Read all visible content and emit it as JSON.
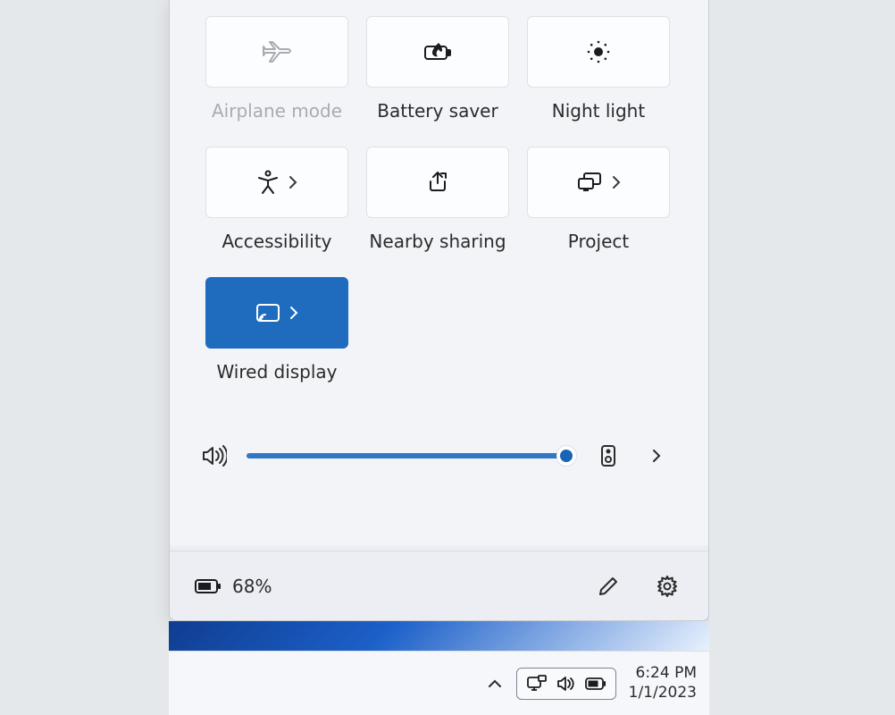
{
  "tiles": {
    "airplane": {
      "label": "Airplane mode"
    },
    "battery_saver": {
      "label": "Battery saver"
    },
    "night_light": {
      "label": "Night light"
    },
    "accessibility": {
      "label": "Accessibility"
    },
    "nearby": {
      "label": "Nearby sharing"
    },
    "project": {
      "label": "Project"
    },
    "wired_display": {
      "label": "Wired display",
      "active": true
    }
  },
  "volume": {
    "percent": 97
  },
  "battery": {
    "percent_label": "68%"
  },
  "taskbar": {
    "time": "6:24 PM",
    "date": "1/1/2023"
  }
}
